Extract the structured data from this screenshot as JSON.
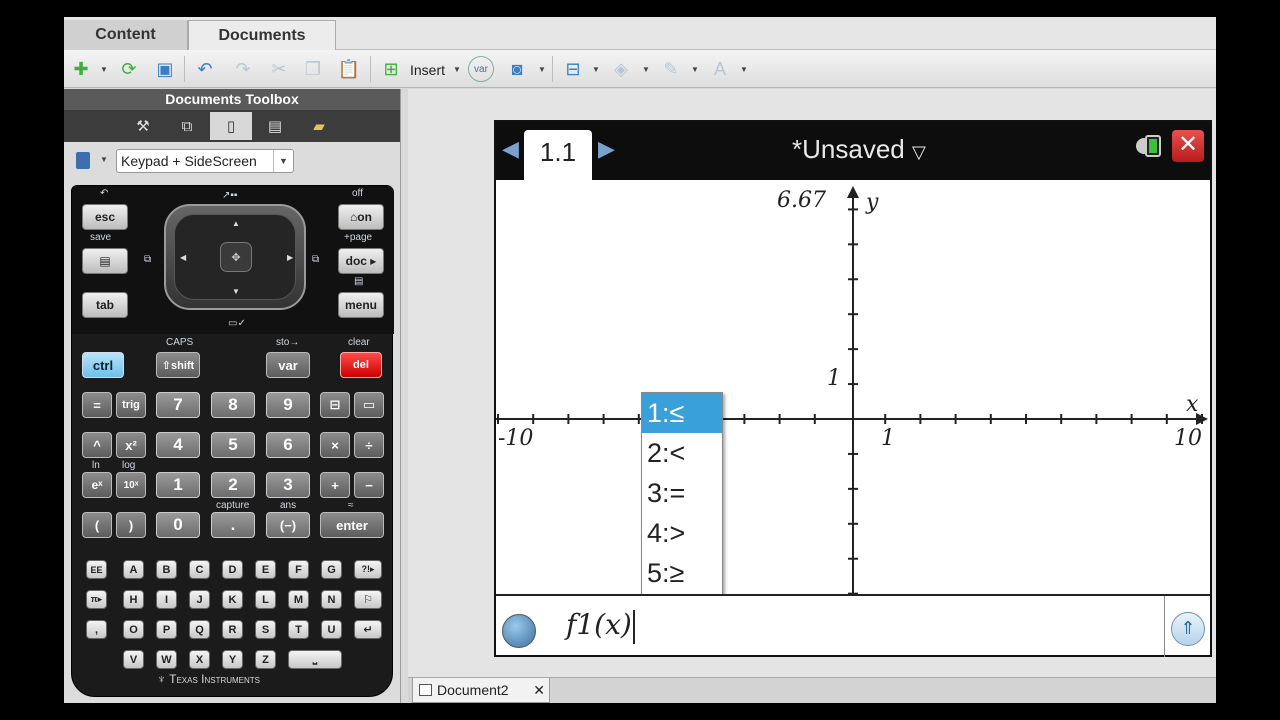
{
  "tabs": {
    "content": "Content",
    "documents": "Documents"
  },
  "toolbar": {
    "insert_label": "Insert",
    "var_label": "var"
  },
  "toolbox": {
    "title": "Documents Toolbox",
    "keypad_select": "Keypad + SideScreen"
  },
  "calculator": {
    "keys": {
      "esc": "esc",
      "home_on": "⌂on",
      "doc": "doc ▸",
      "tab": "tab",
      "menu": "menu",
      "ctrl": "ctrl",
      "shift": "⇧shift",
      "var": "var",
      "del": "del",
      "eq": "=",
      "trig": "trig",
      "n7": "7",
      "n8": "8",
      "n9": "9",
      "caret": "^",
      "sq": "x²",
      "n4": "4",
      "n5": "5",
      "n6": "6",
      "times": "×",
      "div": "÷",
      "ex": "eˣ",
      "tenx": "10ˣ",
      "n1": "1",
      "n2": "2",
      "n3": "3",
      "plus": "+",
      "minus": "−",
      "lparen": "(",
      "rparen": ")",
      "n0": "0",
      "dot": ".",
      "neg": "(−)",
      "enter": "enter",
      "ee": "EE",
      "qmark": "?!▸",
      "pi": "π▸",
      "flag": "⚐",
      "comma": ",",
      "ret": "↵",
      "space": "⎵"
    },
    "labels": {
      "off": "off",
      "save": "save",
      "page": "+page",
      "caps": "CAPS",
      "sto": "sto→",
      "clear": "clear",
      "capture": "capture",
      "ans": "ans",
      "approx": "≈",
      "ln": "ln",
      "log": "log"
    },
    "alpha_rows": [
      [
        "A",
        "B",
        "C",
        "D",
        "E",
        "F",
        "G"
      ],
      [
        "H",
        "I",
        "J",
        "K",
        "L",
        "M",
        "N"
      ],
      [
        "O",
        "P",
        "Q",
        "R",
        "S",
        "T",
        "U"
      ],
      [
        "V",
        "W",
        "X",
        "Y",
        "Z"
      ]
    ],
    "brand": "Texas Instruments"
  },
  "device": {
    "page_tab": "1.1",
    "doc_title": "*Unsaved",
    "graph": {
      "ymax_label": "6.67",
      "y_axis_label": "y",
      "x_axis_label": "x",
      "xmin_label": "-10",
      "xmax_label": "10",
      "x_one_label": "1",
      "y_one_label": "1",
      "xmin": -10,
      "xmax": 10,
      "ymin": -5,
      "ymax": 6.67
    },
    "menu_items": [
      "1:≤",
      "2:<",
      "3:=",
      "4:>",
      "5:≥"
    ],
    "entry_text": "f1(x)"
  },
  "document_tab": {
    "label": "Document2",
    "close": "✕"
  }
}
